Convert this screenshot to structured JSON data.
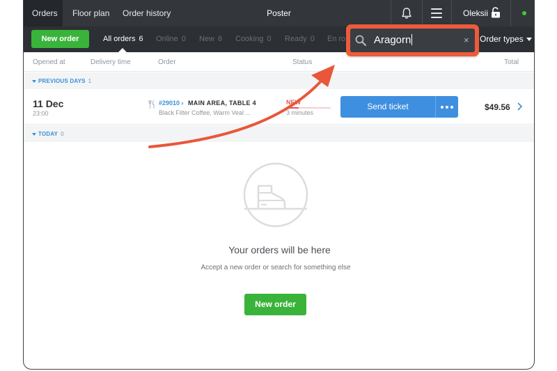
{
  "topbar": {
    "tabs": [
      {
        "label": "Orders"
      },
      {
        "label": "Floor plan"
      },
      {
        "label": "Order history"
      }
    ],
    "app_title": "Poster",
    "user_name": "Oleksii"
  },
  "filters": {
    "new_order_label": "New order",
    "items": [
      {
        "label": "All orders",
        "count": "6"
      },
      {
        "label": "Online",
        "count": "0"
      },
      {
        "label": "New",
        "count": "6"
      },
      {
        "label": "Cooking",
        "count": "0"
      },
      {
        "label": "Ready",
        "count": "0"
      },
      {
        "label": "En rou",
        "count": ""
      }
    ],
    "order_types_label": "Order types"
  },
  "search": {
    "value": "Aragorn",
    "clear_glyph": "×"
  },
  "columns": {
    "opened_at": "Opened at",
    "delivery_time": "Delivery time",
    "order": "Order",
    "status": "Status",
    "total": "Total"
  },
  "groups": {
    "previous": {
      "label": "PREVIOUS DAYS",
      "count": "1"
    },
    "today": {
      "label": "TODAY",
      "count": "0"
    }
  },
  "order": {
    "date": "11 Dec",
    "time": "23:00",
    "number": "#29010 ›",
    "place": "MAIN AREA, TABLE 4",
    "items": "Black Filter Coffee, Warm Veal ...",
    "status": "NEW",
    "elapsed": "3 minutes",
    "send_label": "Send ticket",
    "total": "$49.56"
  },
  "empty_state": {
    "title": "Your orders will be here",
    "subtitle": "Accept a new order or search for something else",
    "button_label": "New order"
  },
  "colors": {
    "topbar": "#33373c",
    "filterbar": "#2c3035",
    "green": "#3ab33a",
    "blue": "#3f8fe0",
    "link_blue": "#3a8fd6",
    "accent_orange": "#ec5b3b",
    "status_red": "#e0565b"
  },
  "icons": [
    "bell-icon",
    "menu-icon",
    "unlock-icon",
    "search-icon",
    "clear-icon",
    "fork-knife-icon",
    "chevron-right-icon",
    "empty-orders-icon"
  ]
}
